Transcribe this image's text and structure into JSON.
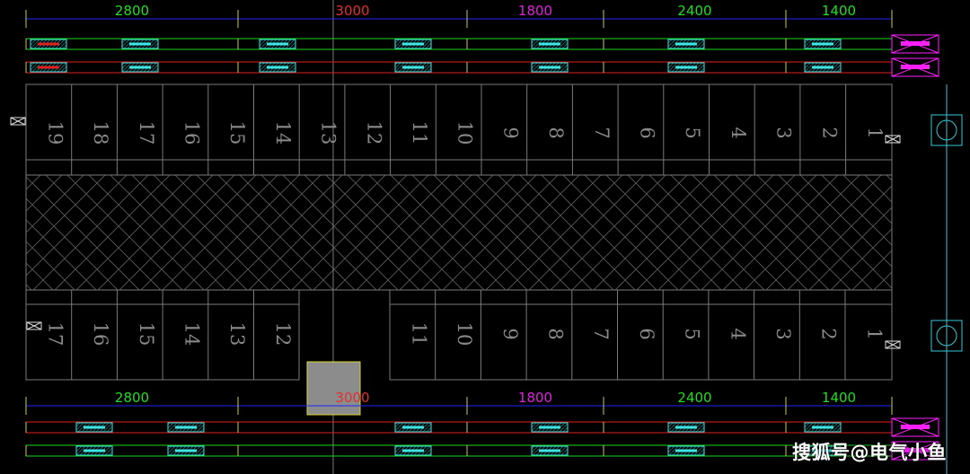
{
  "colors": {
    "background": "#000000",
    "grid_line": "#7a7a7a",
    "hatch": "#5e5e5e",
    "dim_line": "#2222ff",
    "green_rail": "#21d321",
    "red_rail": "#e02020",
    "cyan_marker": "#3ee6e6",
    "magenta_marker": "#ff20ff",
    "tick_yellow": "#c9c95a",
    "gray_block": "#8c8c8c",
    "teal_panel": "#36c8d6"
  },
  "top_dims": [
    {
      "label": "2800",
      "color": "#22dd22"
    },
    {
      "label": "3000",
      "color": "#e03030"
    },
    {
      "label": "1800",
      "color": "#dd22dd"
    },
    {
      "label": "2400",
      "color": "#22dd22"
    },
    {
      "label": "1400",
      "color": "#22dd22"
    }
  ],
  "bottom_dims": [
    {
      "label": "2800",
      "color": "#22dd22"
    },
    {
      "label": "3000",
      "color": "#e03030"
    },
    {
      "label": "1800",
      "color": "#dd22dd"
    },
    {
      "label": "2400",
      "color": "#22dd22"
    },
    {
      "label": "1400",
      "color": "#22dd22"
    }
  ],
  "upper_slots": [
    "19",
    "18",
    "17",
    "16",
    "15",
    "14",
    "13",
    "12",
    "11",
    "10",
    "9",
    "8",
    "7",
    "6",
    "5",
    "4",
    "3",
    "2",
    "1"
  ],
  "lower_left_slots": [
    "17",
    "16",
    "15",
    "14",
    "13",
    "12"
  ],
  "lower_right_slots": [
    "11",
    "10",
    "9",
    "8",
    "7",
    "6",
    "5",
    "4",
    "3",
    "2",
    "1"
  ],
  "watermark": "搜狐号@电气小鱼"
}
